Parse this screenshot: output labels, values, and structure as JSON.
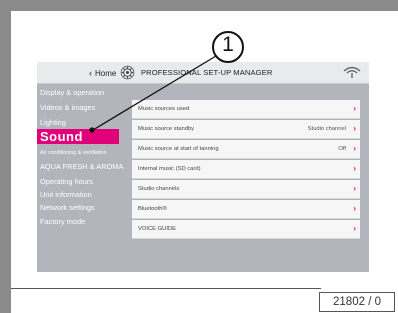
{
  "header": {
    "home_label": "Home",
    "title": "PROFESSIONAL SET-UP MANAGER"
  },
  "sidebar": {
    "items": [
      {
        "label": "Display & operation"
      },
      {
        "label": "Videos & images"
      },
      {
        "label": "Lighting"
      },
      {
        "label": "Sound",
        "active": true
      },
      {
        "label": "Air conditioning & ventilation"
      },
      {
        "label": "AQUA FRESH & AROMA"
      },
      {
        "label": "Operating hours"
      },
      {
        "label": "Unit information"
      },
      {
        "label": "Network settings"
      },
      {
        "label": "Factory mode"
      }
    ]
  },
  "list": {
    "rows": [
      {
        "label": "Music sources used",
        "value": ""
      },
      {
        "label": "Music source standby",
        "value": "Studio channel"
      },
      {
        "label": "Music source at start of tanning",
        "value": "Off"
      },
      {
        "label": "Internal music (SD card)",
        "value": ""
      },
      {
        "label": "Studio channels",
        "value": ""
      },
      {
        "label": "Bluetooth®",
        "value": ""
      },
      {
        "label": "VOICE GUIDE",
        "value": ""
      }
    ]
  },
  "callout": {
    "number": "1"
  },
  "figure_id": "21802 / 0",
  "colors": {
    "accent": "#e2007a",
    "sidebar_bg": "#b2b5bb",
    "header_bg": "#e9eaec",
    "row_bg": "#f6f6f7"
  },
  "icons": {
    "home_chevron": "chevron-left-icon",
    "settings": "gear-icon",
    "connection": "signal-icon",
    "row_arrow": "chevron-right-icon"
  }
}
